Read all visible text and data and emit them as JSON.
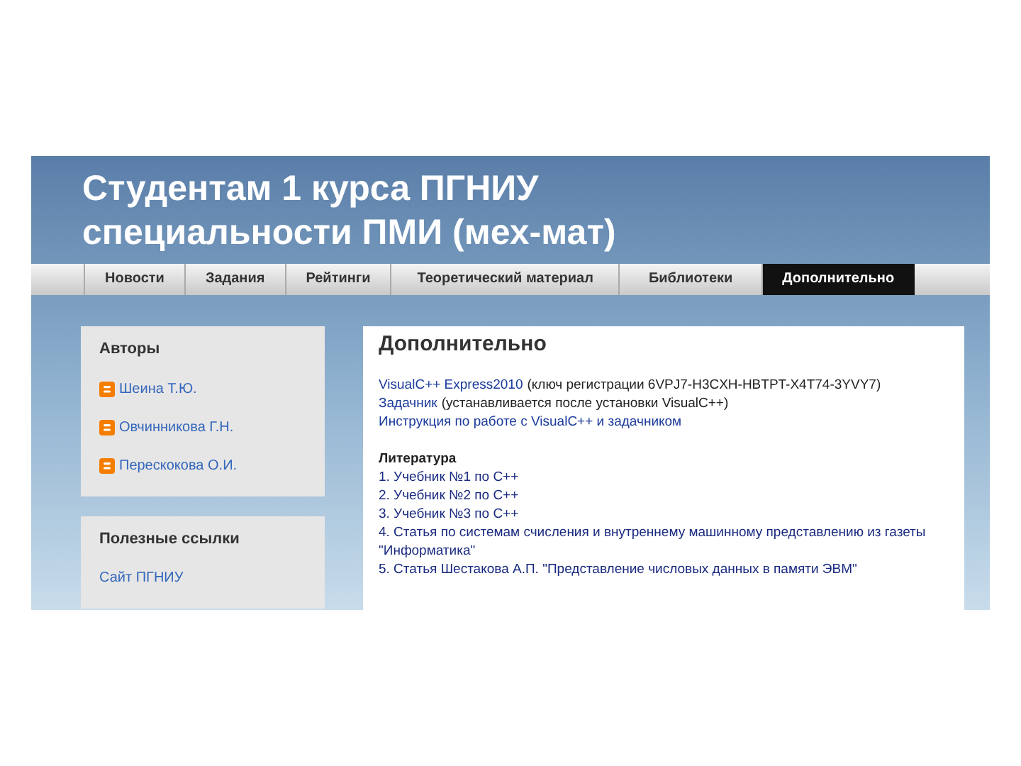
{
  "header": {
    "title_lines": [
      "Студентам 1 курса ПГНИУ",
      "специальности ПМИ (мех-мат)"
    ]
  },
  "tabs": [
    {
      "label": "Новости",
      "selected": false
    },
    {
      "label": "Задания",
      "selected": false
    },
    {
      "label": "Рейтинги",
      "selected": false
    },
    {
      "label": "Теоретический материал",
      "selected": false
    },
    {
      "label": "Библиотеки",
      "selected": false
    },
    {
      "label": "Дополнительно",
      "selected": true
    }
  ],
  "sidebar": [
    {
      "title": "Авторы",
      "items": [
        {
          "kind": "blogger",
          "label": "Шеина Т.Ю."
        },
        {
          "kind": "blogger",
          "label": "Овчинникова Г.Н."
        },
        {
          "kind": "blogger",
          "label": "Перескокова О.И."
        }
      ]
    },
    {
      "title": "Полезные ссылки",
      "items": [
        {
          "kind": "link",
          "label": "Сайт ПГНИУ"
        }
      ]
    }
  ],
  "post": {
    "title": "Дополнительно",
    "lines": [
      [
        {
          "text": "VisualC++ Express2010",
          "link": true
        },
        {
          "text": "(ключ регистрации 6VPJ7-H3CXH-HBTPT-X4T74-3YVY7)",
          "link": false
        }
      ],
      [
        {
          "text": "Задачник",
          "link": true
        },
        {
          "text": "(устанавливается после установки VisualC++)",
          "link": false
        }
      ],
      [
        {
          "text": "Инструкция по работе с VisualC++ и задачником",
          "link": true
        }
      ]
    ],
    "section_title": "Литература",
    "literature": [
      "1. Учебник №1 по С++",
      "2. Учебник №2 по С++",
      "3. Учебник №3 по С++",
      "4. Статья по системам счисления и внутреннему машинному представлению из газеты \"Информатика\"",
      "5. Статья Шестакова А.П. \"Представление числовых данных в памяти ЭВМ\""
    ]
  }
}
